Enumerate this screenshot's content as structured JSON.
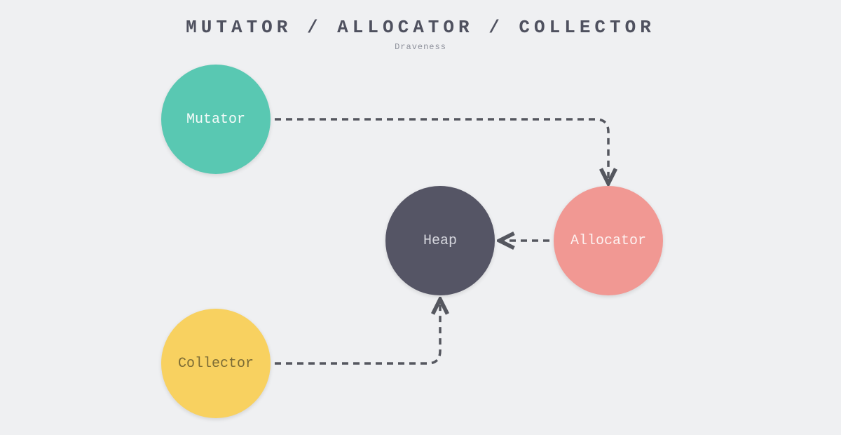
{
  "title": "MUTATOR / ALLOCATOR / COLLECTOR",
  "subtitle": "Draveness",
  "nodes": {
    "mutator": {
      "label": "Mutator",
      "color": "#59c8b2"
    },
    "heap": {
      "label": "Heap",
      "color": "#555565"
    },
    "allocator": {
      "label": "Allocator",
      "color": "#f19893"
    },
    "collector": {
      "label": "Collector",
      "color": "#f8d160"
    }
  },
  "edges": [
    {
      "from": "mutator",
      "to": "allocator"
    },
    {
      "from": "allocator",
      "to": "heap"
    },
    {
      "from": "collector",
      "to": "heap"
    }
  ],
  "arrow_color": "#55575f"
}
